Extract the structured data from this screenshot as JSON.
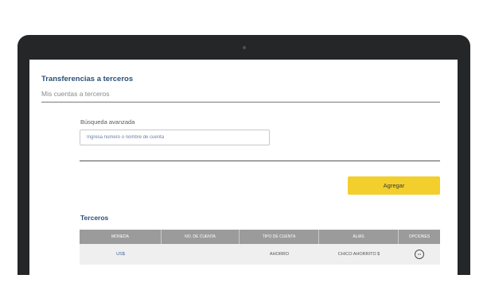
{
  "page": {
    "title": "Transferencias a terceros",
    "subtitle": "Mis cuentas a terceros"
  },
  "search": {
    "label": "Búsqueda avanzada",
    "placeholder": "Ingresa número o nombre de cuenta",
    "value": ""
  },
  "actions": {
    "add_label": "Agregar"
  },
  "terceros": {
    "title": "Terceros",
    "columns": [
      "MONEDA",
      "NO. DE CUENTA",
      "TIPO DE CUENTA",
      "ALIAS",
      "OPCIONES"
    ],
    "rows": [
      {
        "moneda": "US$",
        "cuenta": "",
        "tipo": "AHORRO",
        "alias": "CHICO AHORRITO $",
        "options_icon": "more-options-icon"
      }
    ]
  },
  "colors": {
    "accent": "#f2cf2d",
    "title": "#2b4f7a",
    "table_header": "#9b9b9b",
    "row_bg": "#efefef",
    "device": "#252628"
  }
}
